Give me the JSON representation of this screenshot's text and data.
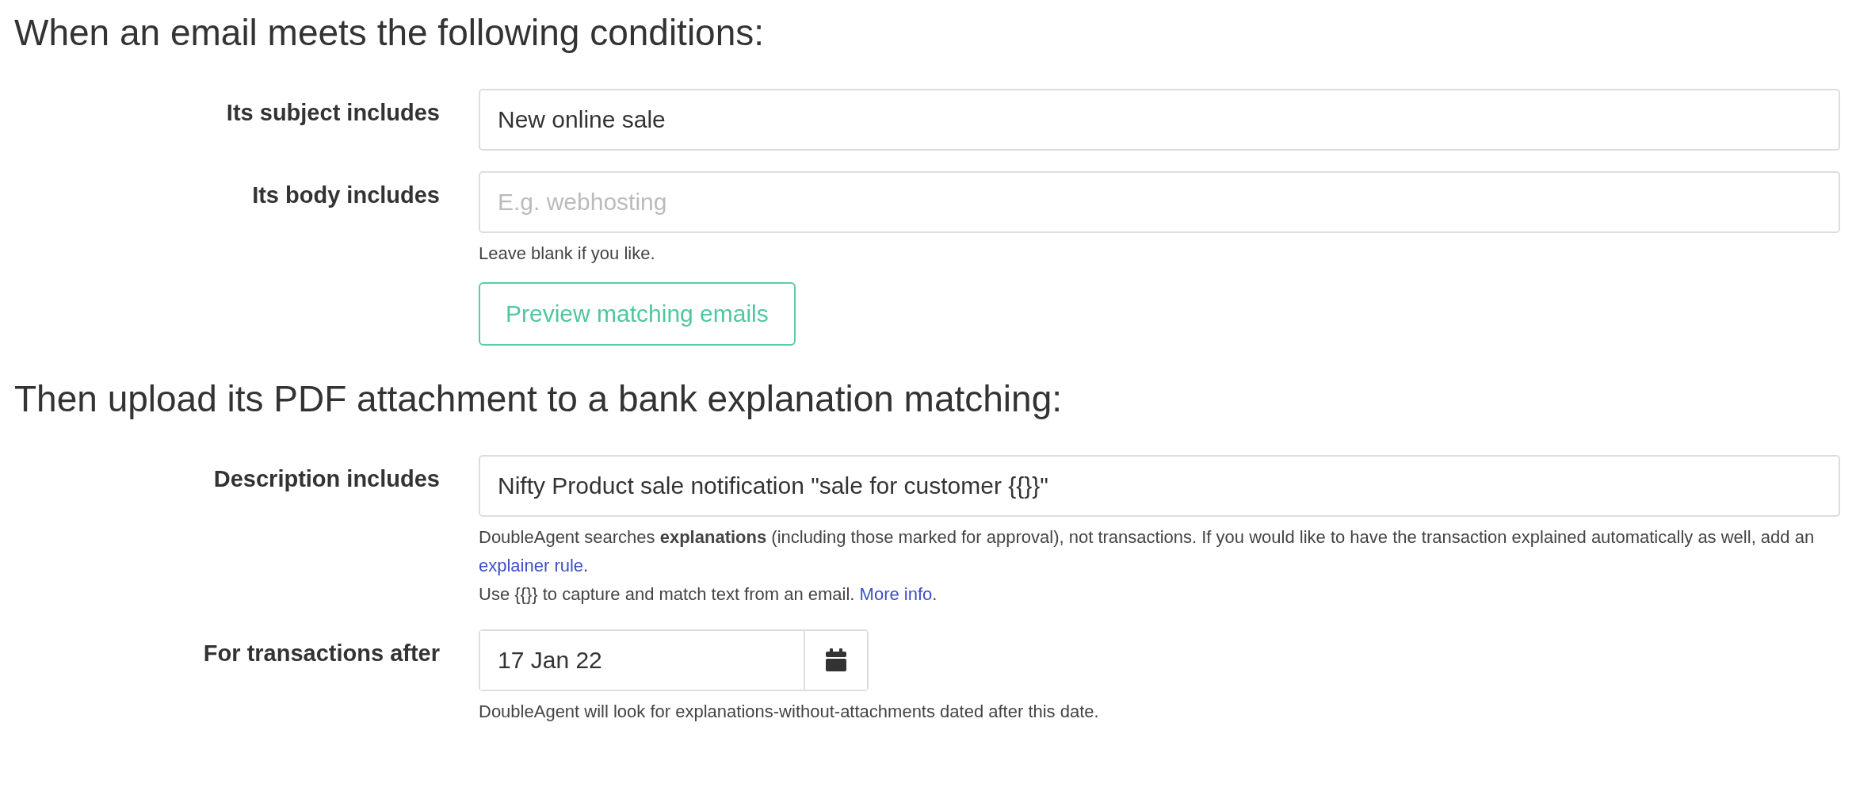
{
  "sections": [
    {
      "heading": "When an email meets the following conditions:",
      "fields": [
        {
          "kind": "text",
          "label": "Its subject includes",
          "value": "New online sale"
        },
        {
          "kind": "text",
          "label": "Its body includes",
          "placeholder": "E.g. webhosting",
          "help": [
            [
              {
                "text": "Leave blank if you like."
              }
            ]
          ],
          "button": "Preview matching emails"
        }
      ]
    },
    {
      "heading": "Then upload its PDF attachment to a bank explanation matching:",
      "fields": [
        {
          "kind": "text",
          "label": "Description includes",
          "value": "Nifty Product sale notification \"sale for customer {{}}\"",
          "help": [
            [
              {
                "text": "DoubleAgent searches **explanations** (including those marked for approval), not transactions. If you would like to have the transaction explained automatically as well, add an "
              },
              {
                "link": "explainer rule"
              },
              {
                "text": "."
              }
            ],
            [
              {
                "text": "Use {{}} to capture and match text from an email. "
              },
              {
                "link": "More info"
              },
              {
                "text": "."
              }
            ]
          ]
        },
        {
          "kind": "date",
          "label": "For transactions after",
          "value": "17 Jan 22",
          "help": [
            [
              {
                "text": "DoubleAgent will look for explanations-without-attachments dated after this date."
              }
            ]
          ]
        }
      ]
    }
  ]
}
